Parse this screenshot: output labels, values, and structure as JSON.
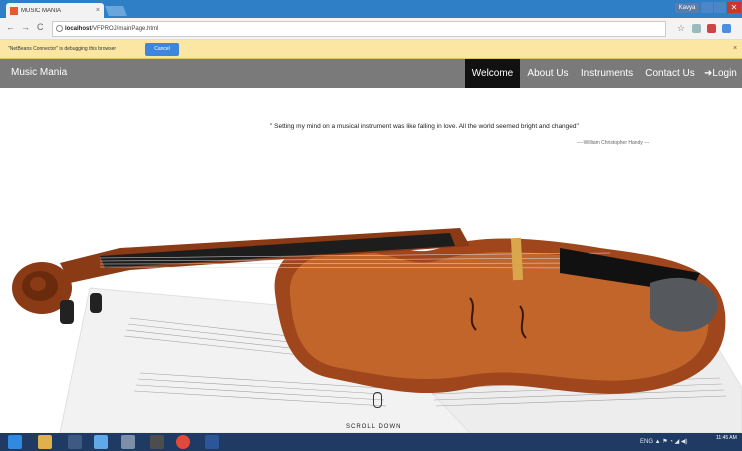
{
  "browser": {
    "tab_title": "MUSIC MANIA",
    "tab_close": "×",
    "user_badge": "Kavya",
    "close_glyph": "✕",
    "back": "←",
    "forward": "→",
    "reload": "C",
    "url_host": "localhost",
    "url_path": "/VFPROJ/mainPage.html",
    "star": "☆"
  },
  "infobar": {
    "message": "\"NetBeans Connector\" is debugging this browser",
    "cancel_label": "Cancel",
    "close": "×"
  },
  "site": {
    "brand": "Music Mania",
    "nav": {
      "welcome": "Welcome",
      "about": "About Us",
      "instruments": "Instruments",
      "contact": "Contact Us",
      "login": "Login"
    },
    "login_icon": "➜"
  },
  "hero": {
    "quote": "\" Setting my mind on a musical instrument was like falling in love. All the world seemed bright and changed\"",
    "author": "----William Christopher Handy ---",
    "scroll_label": "SCROLL DOWN",
    "image": "violin-on-sheet-music"
  },
  "taskbar": {
    "tray": "ENG ▲ ⚑ ◔ ◢ ◀)",
    "clock": "11:45 AM"
  },
  "colors": {
    "titlebar": "#2f7fc6",
    "infobar": "#fbe6a3",
    "site_nav": "#7a7a7a",
    "active_nav": "#111111",
    "taskbar": "#1f3b63"
  }
}
